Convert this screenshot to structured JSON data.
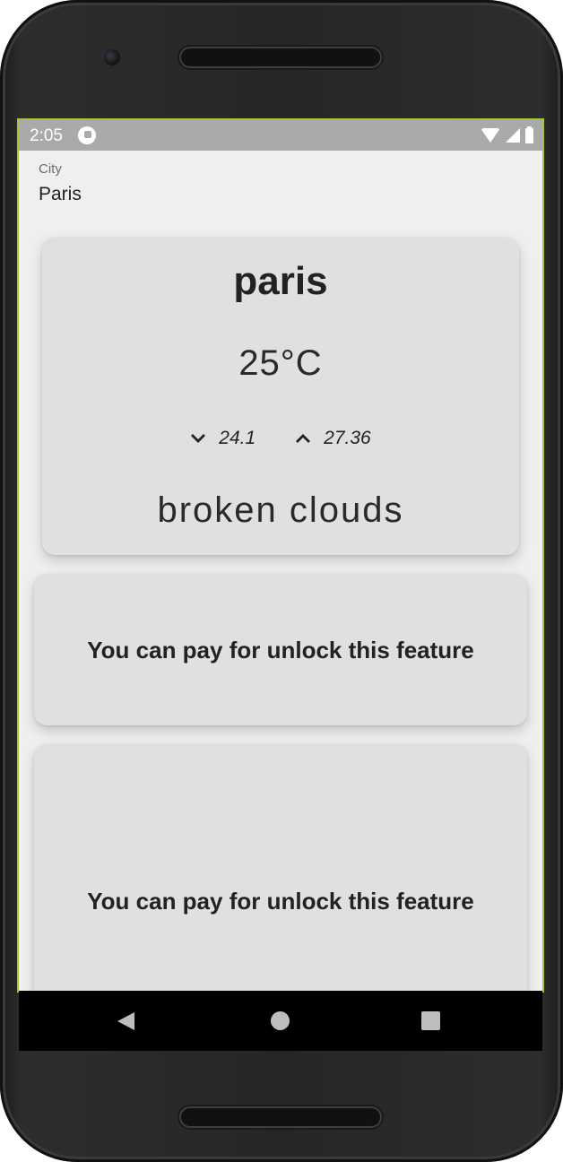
{
  "status_bar": {
    "time": "2:05",
    "icons": [
      "app-notification-icon",
      "wifi-icon",
      "signal-icon",
      "battery-icon"
    ]
  },
  "city_field": {
    "label": "City",
    "value": "Paris"
  },
  "weather": {
    "city": "paris",
    "temperature": "25°C",
    "min_temp": "24.1",
    "max_temp": "27.36",
    "description": "broken clouds",
    "min_icon": "chevron-down-icon",
    "max_icon": "chevron-up-icon"
  },
  "locked_features": [
    {
      "text": "You can pay for unlock this feature"
    },
    {
      "text": "You can pay for unlock this feature"
    }
  ],
  "nav_bar": {
    "icons": [
      "back-icon",
      "home-icon",
      "recents-icon"
    ]
  },
  "colors": {
    "screen_bg": "#efefef",
    "card_bg": "#e0e0e0",
    "status_bar_bg": "#aaaaaa",
    "screen_border": "#a2c53b"
  }
}
